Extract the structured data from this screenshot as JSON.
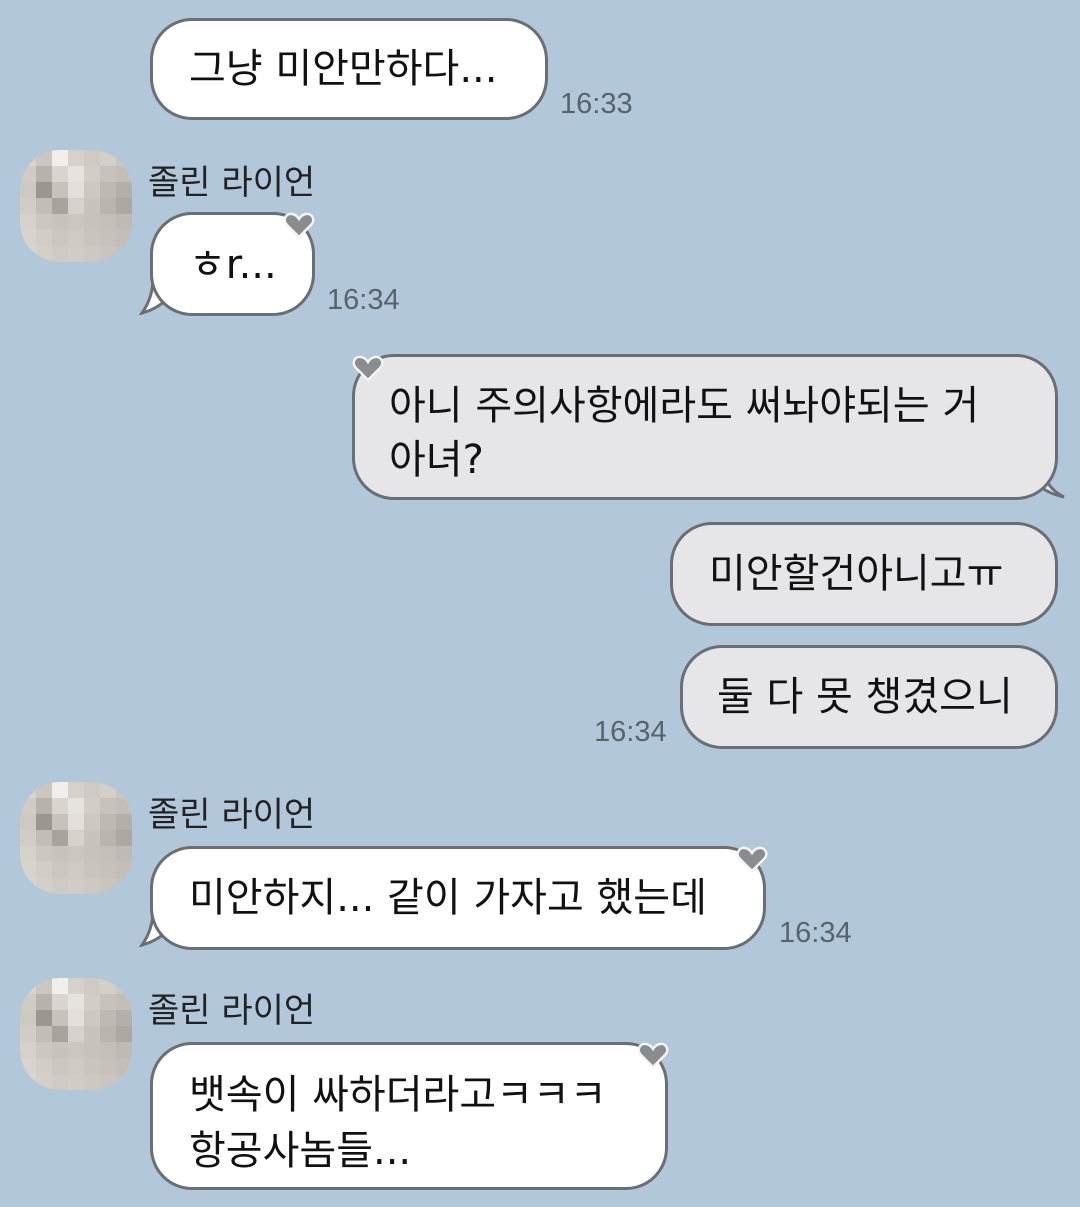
{
  "messages": [
    {
      "text": "그냥 미안만하다...",
      "time": "16:33"
    },
    {
      "sender": "졸린 라이언",
      "text": "ㅎr...",
      "time": "16:34"
    },
    {
      "text_lines": [
        "아니 주의사항에라도 써놔야되는 거",
        "아녀?"
      ]
    },
    {
      "text": "미안할건아니고ㅠ"
    },
    {
      "text": "둘 다 못 챙겼으니",
      "time": "16:34"
    },
    {
      "sender": "졸린 라이언",
      "text": "미안하지... 같이 가자고 했는데",
      "time": "16:34"
    },
    {
      "sender": "졸린 라이언",
      "text_lines": [
        "뱃속이 싸하더라고ㅋㅋㅋ",
        "항공사놈들..."
      ]
    }
  ],
  "colors": {
    "background": "#b2c7d9",
    "incoming_bubble": "#ffffff",
    "outgoing_bubble": "#e6e6e8",
    "bubble_border": "#6b6e72",
    "timestamp": "#59636e"
  },
  "icons": {
    "avatar": "pixelated-profile-avatar",
    "bubble_decoration": "heart-icon"
  }
}
